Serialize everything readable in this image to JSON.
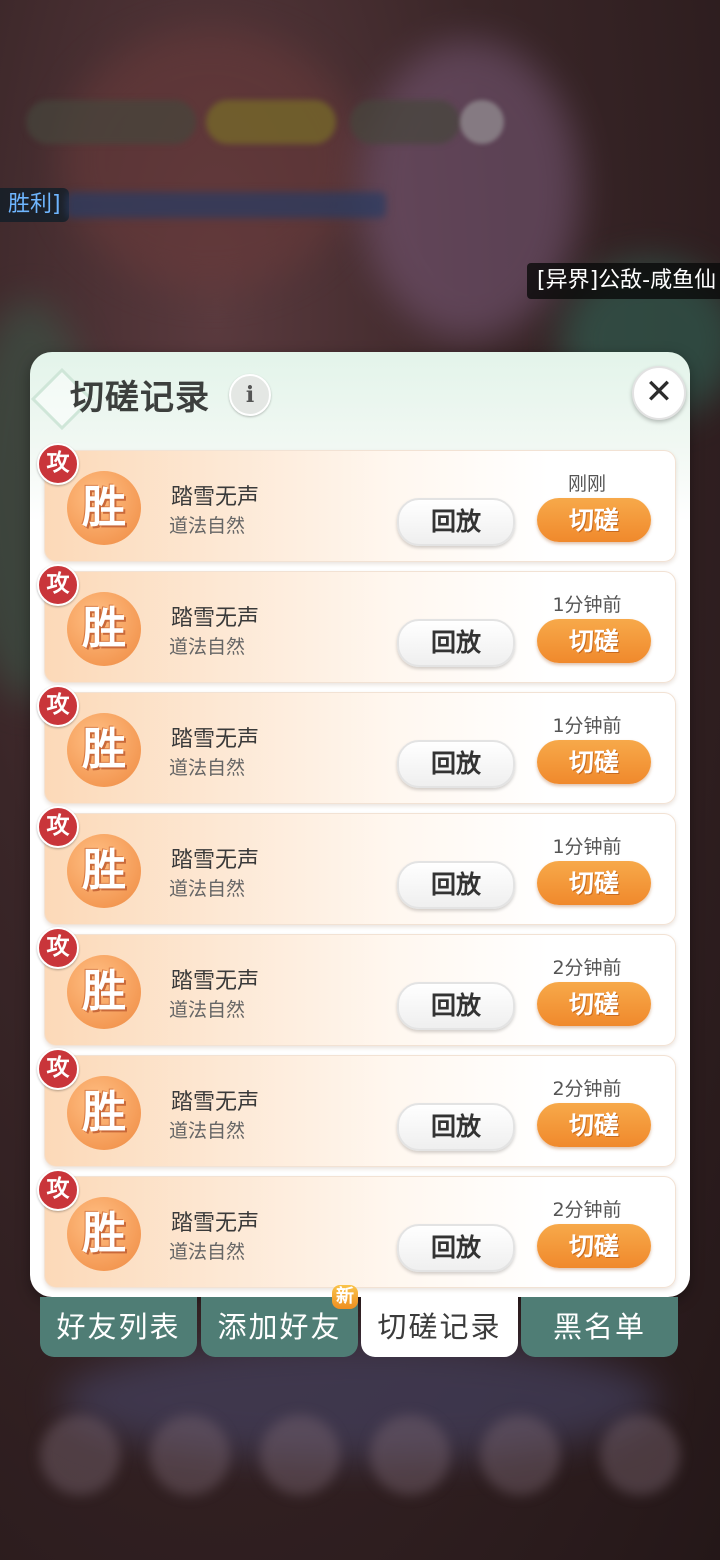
{
  "background": {
    "left_tag": "胜利]",
    "right_tag": "[异界]公敌-咸鱼仙"
  },
  "panel": {
    "title": "切磋记录",
    "info_symbol": "i",
    "close_symbol": "✕"
  },
  "records": [
    {
      "badge": "攻",
      "result": "胜",
      "name": "踏雪无声",
      "school": "道法自然",
      "time": "刚刚",
      "replay_label": "回放",
      "spar_label": "切磋"
    },
    {
      "badge": "攻",
      "result": "胜",
      "name": "踏雪无声",
      "school": "道法自然",
      "time": "1分钟前",
      "replay_label": "回放",
      "spar_label": "切磋"
    },
    {
      "badge": "攻",
      "result": "胜",
      "name": "踏雪无声",
      "school": "道法自然",
      "time": "1分钟前",
      "replay_label": "回放",
      "spar_label": "切磋"
    },
    {
      "badge": "攻",
      "result": "胜",
      "name": "踏雪无声",
      "school": "道法自然",
      "time": "1分钟前",
      "replay_label": "回放",
      "spar_label": "切磋"
    },
    {
      "badge": "攻",
      "result": "胜",
      "name": "踏雪无声",
      "school": "道法自然",
      "time": "2分钟前",
      "replay_label": "回放",
      "spar_label": "切磋"
    },
    {
      "badge": "攻",
      "result": "胜",
      "name": "踏雪无声",
      "school": "道法自然",
      "time": "2分钟前",
      "replay_label": "回放",
      "spar_label": "切磋"
    },
    {
      "badge": "攻",
      "result": "胜",
      "name": "踏雪无声",
      "school": "道法自然",
      "time": "2分钟前",
      "replay_label": "回放",
      "spar_label": "切磋"
    }
  ],
  "tabs": [
    {
      "label": "好友列表",
      "active": false
    },
    {
      "label": "添加好友",
      "active": false,
      "badge": "新"
    },
    {
      "label": "切磋记录",
      "active": true
    },
    {
      "label": "黑名单",
      "active": false
    }
  ]
}
